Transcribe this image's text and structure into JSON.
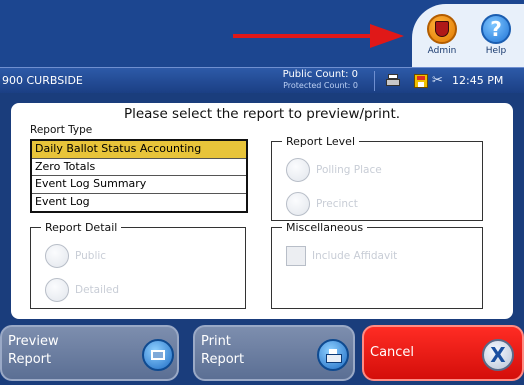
{
  "header": {
    "admin_label": "Admin",
    "help_label": "Help",
    "help_glyph": "?",
    "icons": {
      "admin": "shield-icon",
      "help": "help-question-icon",
      "arrow": "red-arrow"
    },
    "colors": {
      "arrow": "#e01818",
      "admin_icon": "#f08c00",
      "help_icon": "#2a86e6"
    }
  },
  "status_bar": {
    "precinct_name": "900 CURBSIDE",
    "public_count": "Public Count: 0",
    "protected_count": "Protected Count: 0",
    "plug_glyph": "✂",
    "time": "12:45 PM",
    "icons": [
      "printer-icon",
      "save-icon",
      "plug-icon"
    ]
  },
  "main": {
    "prompt": "Please select the report to preview/print.",
    "report_type": {
      "label": "Report Type",
      "items": [
        {
          "label": "Daily Ballot Status Accounting",
          "selected": true
        },
        {
          "label": "Zero Totals",
          "selected": false
        },
        {
          "label": "Event Log Summary",
          "selected": false
        },
        {
          "label": "Event Log",
          "selected": false
        }
      ],
      "selected_color": "#e8c43a"
    },
    "report_level": {
      "legend": "Report Level",
      "options": [
        {
          "label": "Polling Place",
          "enabled": false
        },
        {
          "label": "Precinct",
          "enabled": false
        }
      ]
    },
    "report_detail": {
      "legend": "Report Detail",
      "options": [
        {
          "label": "Public",
          "enabled": false
        },
        {
          "label": "Detailed",
          "enabled": false
        }
      ]
    },
    "miscellaneous": {
      "legend": "Miscellaneous",
      "options": [
        {
          "label": "Include Affidavit",
          "enabled": false,
          "checked": false
        }
      ]
    }
  },
  "buttons": {
    "preview": {
      "line1": "Preview",
      "line2": "Report",
      "icon": "preview-screen-icon"
    },
    "print": {
      "line1": "Print",
      "line2": "Report",
      "icon": "printer-icon"
    },
    "cancel": {
      "label": "Cancel",
      "glyph": "X",
      "icon": "cancel-x-icon",
      "color": "#e8140e"
    }
  }
}
